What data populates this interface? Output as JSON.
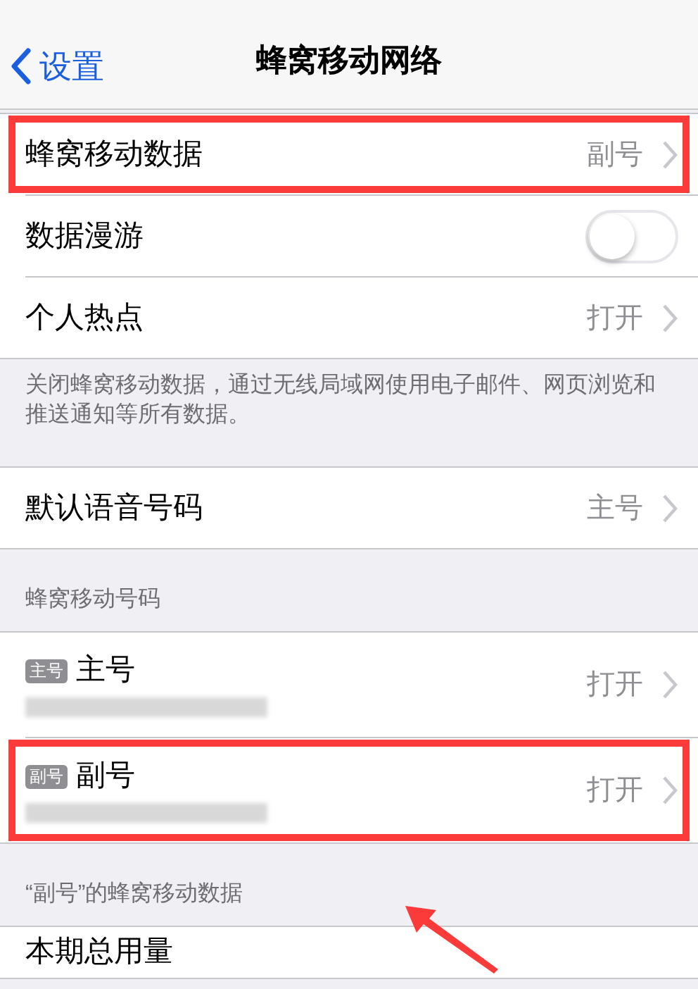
{
  "nav": {
    "back_label": "设置",
    "title": "蜂窝移动网络"
  },
  "sections": [
    {
      "rows": [
        {
          "kind": "disclosure",
          "label": "蜂窝移动数据",
          "value": "副号",
          "highlighted": true
        },
        {
          "kind": "toggle",
          "label": "数据漫游",
          "on": false,
          "highlighted": false
        },
        {
          "kind": "disclosure",
          "label": "个人热点",
          "value": "打开",
          "highlighted": false
        }
      ],
      "footer": "关闭蜂窝移动数据，通过无线局域网使用电子邮件、网页浏览和推送通知等所有数据。"
    },
    {
      "rows": [
        {
          "kind": "disclosure",
          "label": "默认语音号码",
          "value": "主号",
          "highlighted": false
        }
      ]
    },
    {
      "header": "蜂窝移动号码",
      "rows": [
        {
          "kind": "sim",
          "badge": "主号",
          "label": "主号",
          "value": "打开",
          "highlighted": false
        },
        {
          "kind": "sim",
          "badge": "副号",
          "label": "副号",
          "value": "打开",
          "highlighted": true
        }
      ]
    },
    {
      "header": "“副号”的蜂窝移动数据",
      "rows": [
        {
          "kind": "partial",
          "label": "本期总用量",
          "highlighted": false
        }
      ]
    }
  ]
}
